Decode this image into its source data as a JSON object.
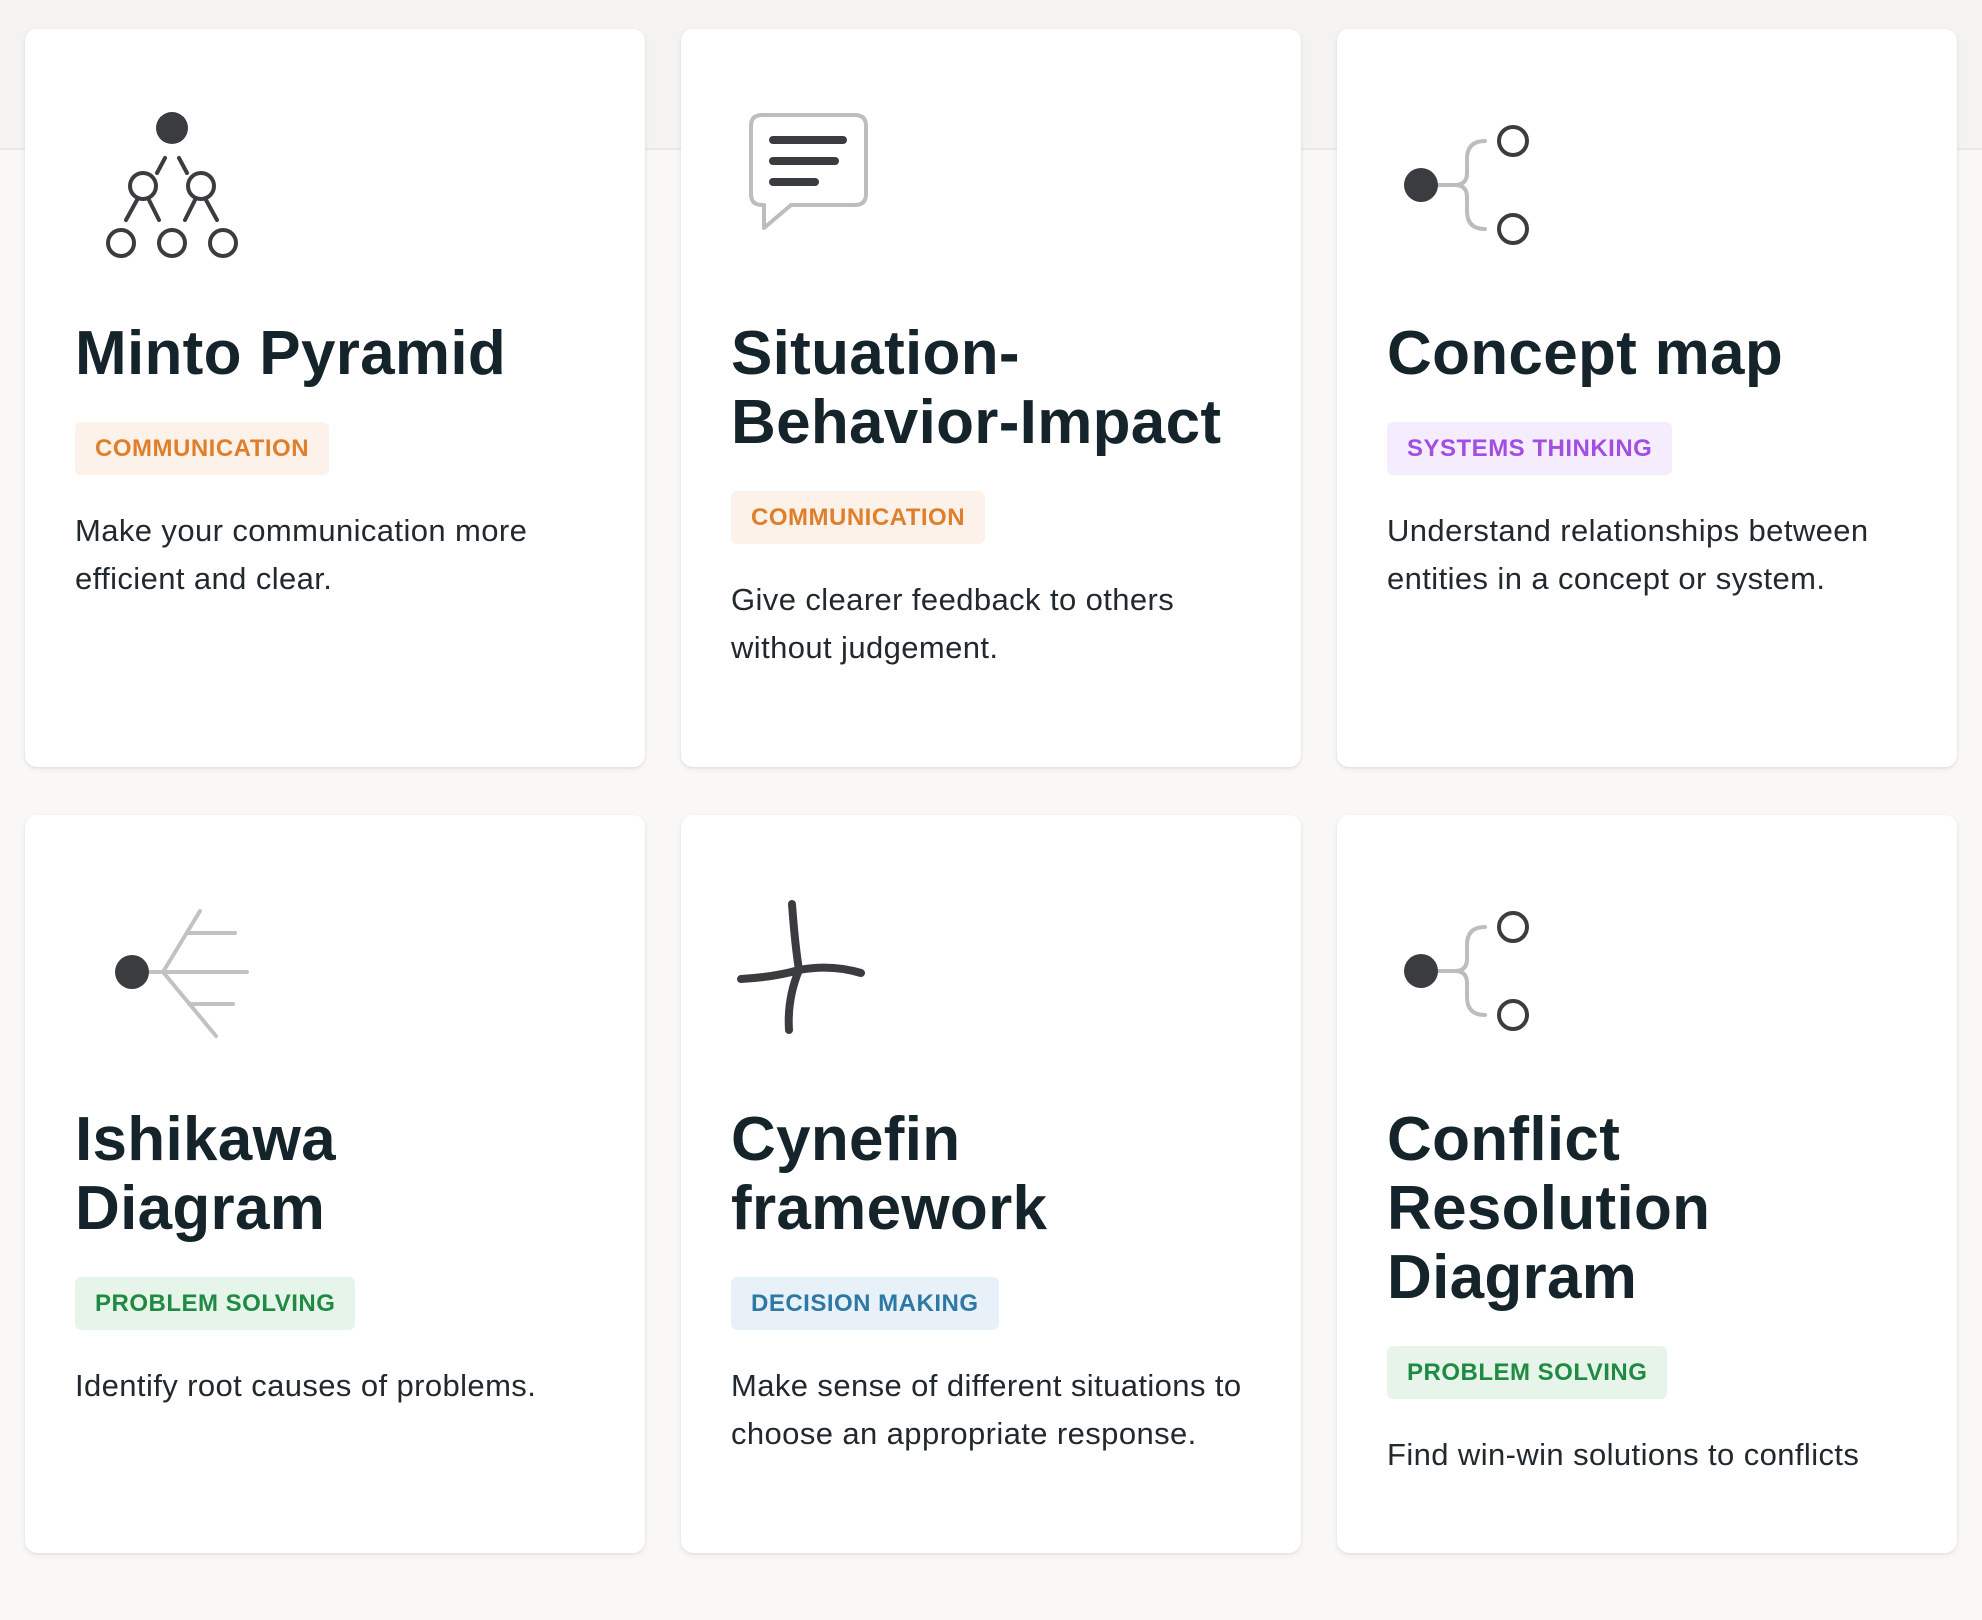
{
  "colors": {
    "communication": "#e07f2b",
    "systems_thinking": "#a24ee0",
    "problem_solving": "#1f8a43",
    "decision_making": "#2e78a6",
    "title": "#15232a"
  },
  "cards": [
    {
      "icon": "pyramid-tree-icon",
      "title": "Minto Pyramid",
      "tag": "COMMUNICATION",
      "description": "Make your communication more efficient and clear."
    },
    {
      "icon": "speech-bubble-icon",
      "title": "Situation-Behavior-Impact",
      "tag": "COMMUNICATION",
      "description": "Give clearer feedback to others without judgement."
    },
    {
      "icon": "concept-branch-icon",
      "title": "Concept map",
      "tag": "SYSTEMS THINKING",
      "description": "Understand relationships between entities in a concept or system."
    },
    {
      "icon": "fishbone-icon",
      "title": "Ishikawa Diagram",
      "tag": "PROBLEM SOLVING",
      "description": "Identify root causes of problems."
    },
    {
      "icon": "cynefin-cross-icon",
      "title": "Cynefin framework",
      "tag": "DECISION MAKING",
      "description": "Make sense of different situations to choose an appropriate response."
    },
    {
      "icon": "conflict-branch-icon",
      "title": "Conflict Resolution Diagram",
      "tag": "PROBLEM SOLVING",
      "description": "Find win-win solutions to conflicts"
    }
  ]
}
